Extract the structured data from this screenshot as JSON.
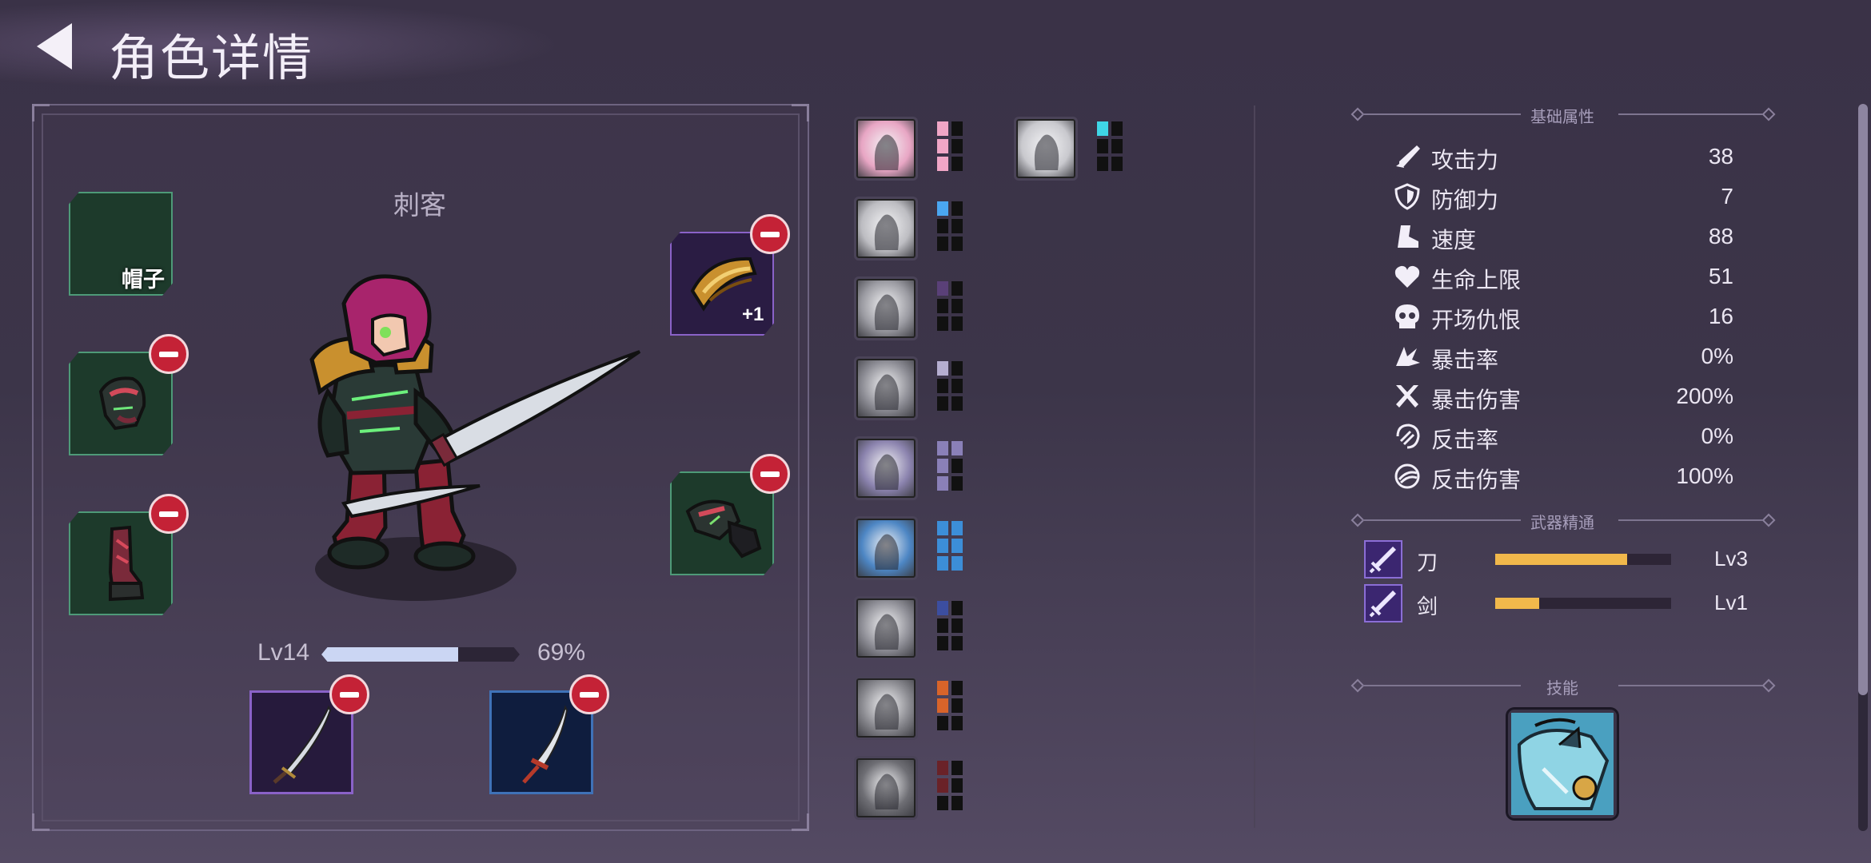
{
  "header": {
    "title": "角色详情"
  },
  "character": {
    "class_name": "刺客",
    "level_label": "Lv14",
    "xp_percent_label": "69%",
    "xp_fraction": 0.69
  },
  "equipment": {
    "hat_slot_label": "帽子",
    "shoulder_badge": "+1"
  },
  "stats": {
    "section_title": "基础属性",
    "items": [
      {
        "label": "攻击力",
        "value": "38",
        "icon": "sword-icon"
      },
      {
        "label": "防御力",
        "value": "7",
        "icon": "shield-icon"
      },
      {
        "label": "速度",
        "value": "88",
        "icon": "boot-icon"
      },
      {
        "label": "生命上限",
        "value": "51",
        "icon": "heart-icon"
      },
      {
        "label": "开场仇恨",
        "value": "16",
        "icon": "skull-icon"
      },
      {
        "label": "暴击率",
        "value": "0%",
        "icon": "crit-icon"
      },
      {
        "label": "暴击伤害",
        "value": "200%",
        "icon": "crossed-swords-icon"
      },
      {
        "label": "反击率",
        "value": "0%",
        "icon": "counter-icon"
      },
      {
        "label": "反击伤害",
        "value": "100%",
        "icon": "counter-damage-icon"
      }
    ]
  },
  "weapon_mastery": {
    "section_title": "武器精通",
    "items": [
      {
        "name": "刀",
        "level": "Lv3",
        "progress": 0.75
      },
      {
        "name": "剑",
        "level": "Lv1",
        "progress": 0.25
      }
    ]
  },
  "skills": {
    "section_title": "技能"
  },
  "colors": {
    "pip_pink": "#f0a6c6",
    "pip_cyan": "#3fd6e6",
    "pip_blue": "#4aa6f0",
    "pip_purple": "#5a4078",
    "pip_lavender": "#b5aed0",
    "pip_violet": "#8a80b8",
    "pip_skyblue": "#3c8ed8",
    "pip_indigo": "#3c4ea0",
    "pip_orange": "#d8642a",
    "pip_maroon": "#6a2228"
  }
}
